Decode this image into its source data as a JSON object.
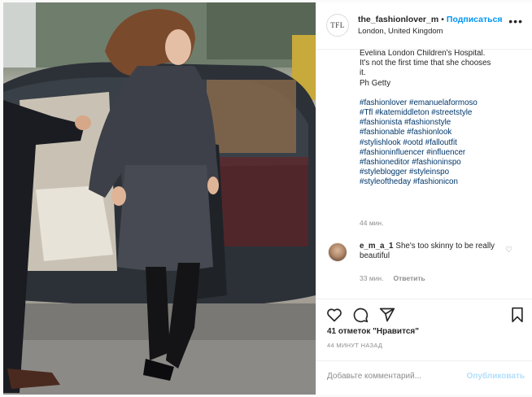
{
  "post": {
    "header": {
      "avatar_text": "TFL",
      "username": "the_fashionlover_m",
      "separator": "•",
      "follow_label": "Подписаться",
      "location": "London, United Kingdom",
      "more_label": "•••"
    },
    "caption": {
      "lines": [
        "Evelina London Children's Hospital.",
        "It's not the first time that she chooses",
        "it.",
        "Ph Getty"
      ],
      "hashtags": [
        "#fashionlover",
        "#emanuelaformoso",
        "#Tfl",
        "#katemiddleton",
        "#streetstyle",
        "#fashionista",
        "#fashionstyle",
        "#fashionable",
        "#fashionlook",
        "#stylishlook",
        "#ootd",
        "#falloutfit",
        "#fashioninfluencer",
        "#influencer",
        "#fashioneditor",
        "#fashioninspo",
        "#styleblogger",
        "#styleinspo",
        "#styleoftheday",
        "#fashionicon"
      ],
      "time": "44 мин."
    },
    "comments": [
      {
        "username": "e_m_a_1",
        "text": "She's too skinny to be really beautiful",
        "time": "33 мин.",
        "reply_label": "Ответить"
      }
    ],
    "likes": "41 отметок \"Нравится\"",
    "posted_ago": "44 МИНУТ НАЗАД",
    "add_comment": {
      "placeholder": "Добавьте комментарий...",
      "post_label": "Опубликовать"
    },
    "icons": [
      "heart-icon",
      "comment-icon",
      "share-icon",
      "bookmark-icon"
    ],
    "colors": {
      "link": "#00376b",
      "accent": "#0095f6",
      "muted": "#8e8e8e"
    }
  }
}
